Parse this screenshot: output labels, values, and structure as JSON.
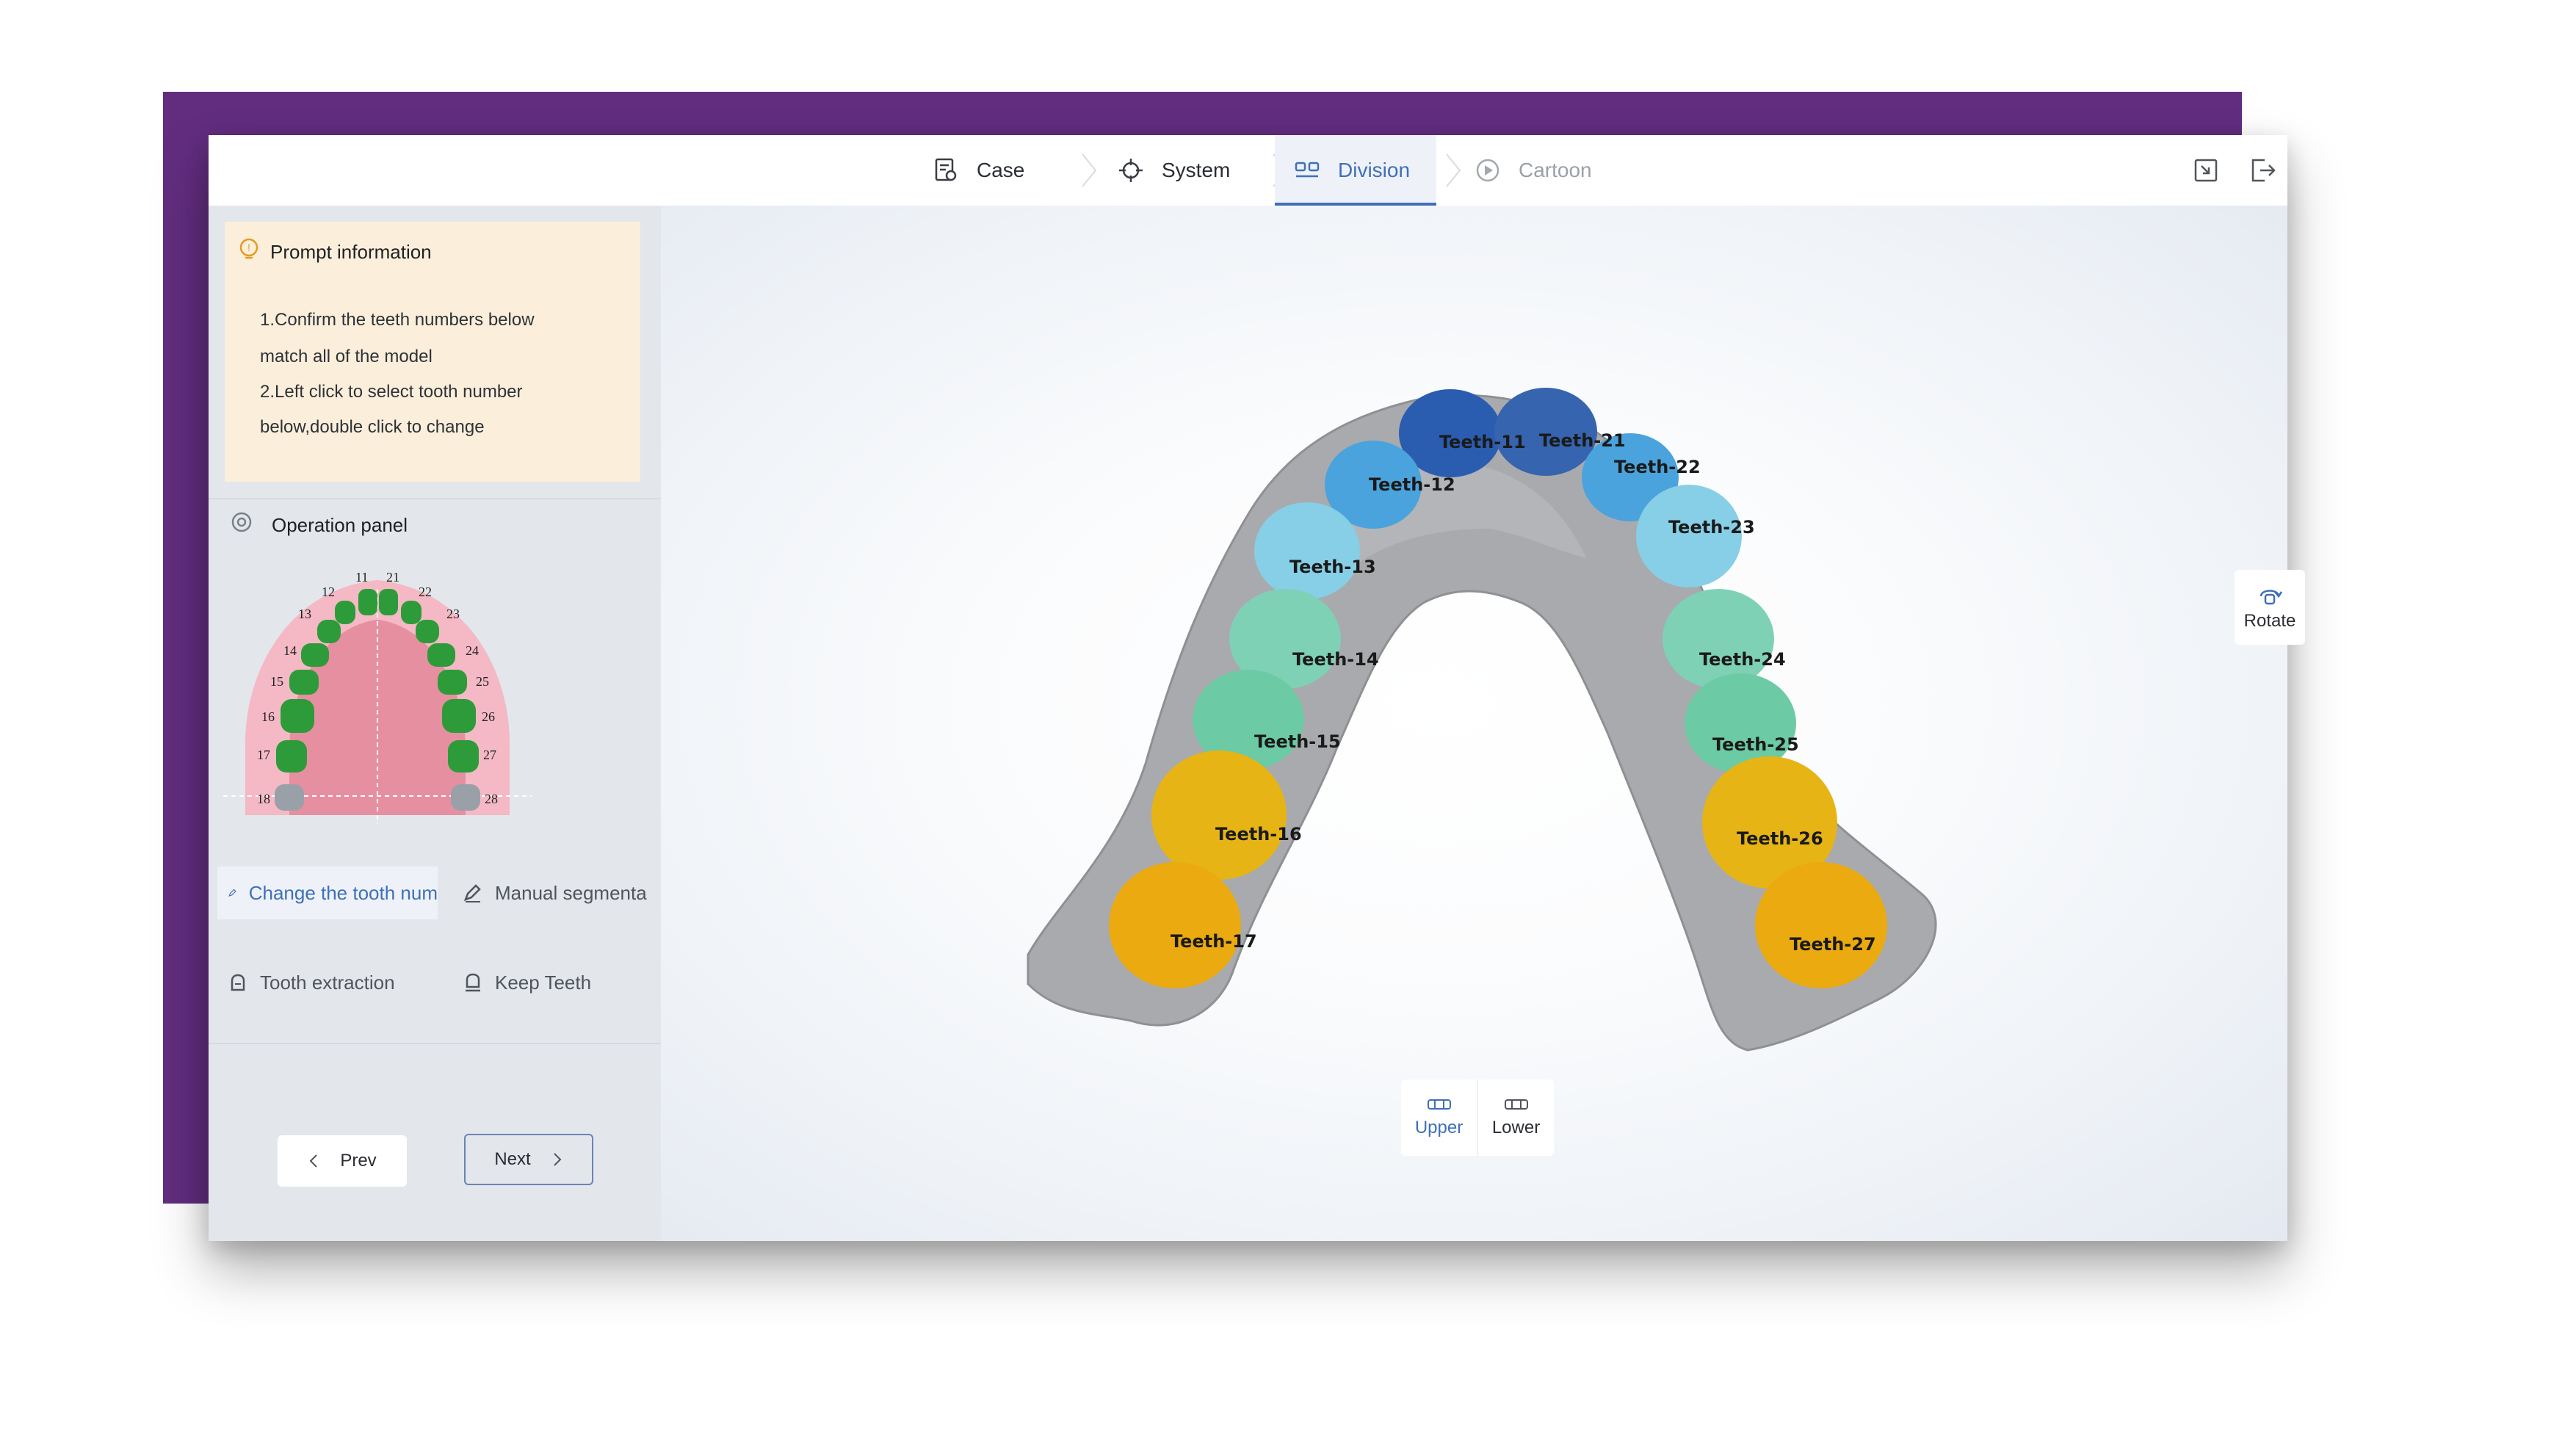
{
  "steps": [
    {
      "label": "Case",
      "state": "done"
    },
    {
      "label": "System",
      "state": "done"
    },
    {
      "label": "Division",
      "state": "active"
    },
    {
      "label": "Cartoon",
      "state": "disabled"
    }
  ],
  "prompt": {
    "title": "Prompt information",
    "lines": [
      "1.Confirm the teeth numbers below",
      "match all of the model",
      "2.Left click to select tooth number",
      "below,double click to change"
    ]
  },
  "operation_panel": {
    "title": "Operation panel",
    "tooth_numbers": [
      "11",
      "12",
      "13",
      "14",
      "15",
      "16",
      "17",
      "18",
      "21",
      "22",
      "23",
      "24",
      "25",
      "26",
      "27",
      "28"
    ]
  },
  "tools": {
    "change_tooth_number": "Change the tooth num",
    "manual_segmentation": "Manual segmenta",
    "tooth_extraction": "Tooth extraction",
    "keep_teeth": "Keep Teeth"
  },
  "nav": {
    "prev": "Prev",
    "next": "Next"
  },
  "viewport": {
    "rotate": "Rotate",
    "upper": "Upper",
    "lower": "Lower",
    "selected_jaw": "Upper",
    "tooth_labels": [
      "Teeth-11",
      "Teeth-21",
      "Teeth-12",
      "Teeth-22",
      "Teeth-13",
      "Teeth-23",
      "Teeth-14",
      "Teeth-24",
      "Teeth-15",
      "Teeth-25",
      "Teeth-16",
      "Teeth-26",
      "Teeth-17",
      "Teeth-27"
    ]
  },
  "colors": {
    "accent": "#3f6fb8",
    "frame": "#622d7f",
    "tooth_green": "#2e9b3a",
    "palate_pink": "#e8a2b0",
    "incisor_dark": "#2a5db0",
    "incisor_light": "#4aa3dc",
    "canine": "#86cfe6",
    "premolar": "#7fd1b5",
    "molar": "#e6b415"
  }
}
